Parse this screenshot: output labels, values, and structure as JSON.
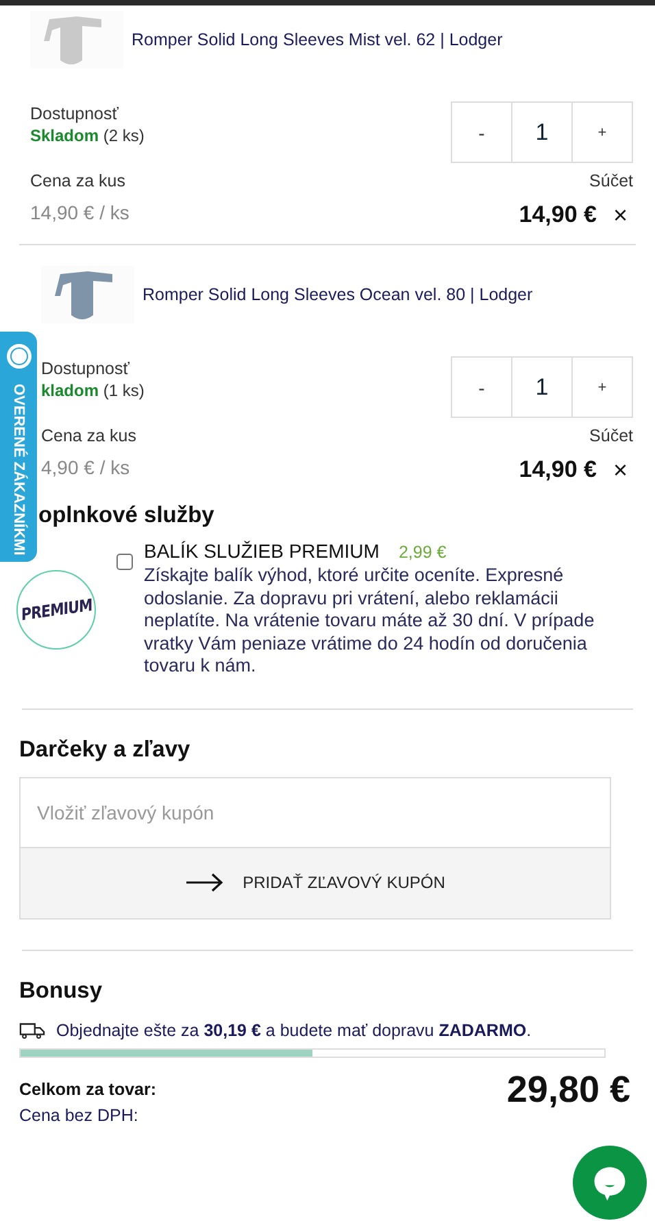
{
  "products": [
    {
      "name": "Romper Solid Long Sleeves Mist vel. 62 | Lodger",
      "availability_label": "Dostupnosť",
      "stock_status": "Skladom",
      "stock_count": "(2 ks)",
      "qty_minus": "-",
      "quantity": "1",
      "qty_plus": "+",
      "unit_price_label": "Cena za kus",
      "unit_price": "14,90 € / ks",
      "total_label": "Súčet",
      "total": "14,90 €",
      "remove": "×"
    },
    {
      "name": "Romper Solid Long Sleeves Ocean vel. 80 | Lodger",
      "availability_label": "Dostupnosť",
      "stock_status": "kladom",
      "stock_count": "(1 ks)",
      "qty_minus": "-",
      "quantity": "1",
      "qty_plus": "+",
      "unit_price_label": "Cena za kus",
      "unit_price": "4,90 € / ks",
      "total_label": "Súčet",
      "total": "14,90 €",
      "remove": "×"
    }
  ],
  "side_tab": {
    "label": "OVERENÉ ZÁKAZNÍKMI"
  },
  "services": {
    "heading": "oplnkové služby",
    "items": [
      {
        "logo_text": "PREMIUM",
        "title": "BALÍK SLUŽIEB PREMIUM",
        "price": "2,99 €",
        "checked": false,
        "description": "Získajte balík výhod, ktoré určite oceníte. Expresné odoslanie. Za dopravu pri vrátení, alebo reklamácii neplatíte. Na vrátenie tovaru máte až 30 dní. V prípade vratky Vám peniaze vrátime do 24 hodín od doručenia tovaru k nám."
      }
    ]
  },
  "gifts": {
    "heading": "Darčeky a zľavy",
    "coupon_placeholder": "Vložiť zľavový kupón",
    "add_button": "PRIDAŤ ZĽAVOVÝ KUPÓN"
  },
  "bonuses": {
    "heading": "Bonusy",
    "shipping_message": "Objednajte ešte za **30,19 €** a budete mať dopravu **ZADARMO**.",
    "level": 0.5
  },
  "summary": {
    "total_label": "Celkom za tovar:",
    "total": "29,80 €",
    "net_label": "Cena bez DPH:"
  }
}
